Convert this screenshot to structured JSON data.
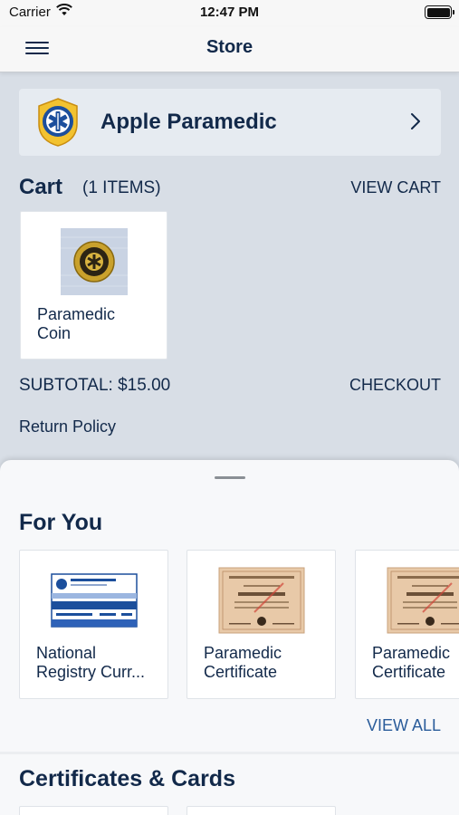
{
  "status_bar": {
    "carrier": "Carrier",
    "time": "12:47 PM"
  },
  "nav": {
    "title": "Store",
    "menu_icon": "hamburger-menu-icon"
  },
  "store": {
    "name": "Apple Paramedic",
    "chevron_icon": "chevron-right-icon",
    "logo_icon": "ems-star-of-life-logo"
  },
  "cart": {
    "title": "Cart",
    "count_label": "(1 ITEMS)",
    "view_cart_label": "VIEW CART",
    "items": [
      {
        "name_line1": "Paramedic",
        "name_line2": "Coin"
      }
    ],
    "subtotal_label": "SUBTOTAL: $15.00",
    "checkout_label": "CHECKOUT",
    "return_policy_label": "Return Policy"
  },
  "for_you": {
    "title": "For You",
    "view_all_label": "VIEW ALL",
    "products": [
      {
        "name_line1": "National",
        "name_line2": "Registry Curr..."
      },
      {
        "name_line1": "Paramedic",
        "name_line2": "Certificate"
      },
      {
        "name_line1": "Paramedic",
        "name_line2": "Certificate"
      }
    ]
  },
  "certificates": {
    "title": "Certificates & Cards"
  },
  "colors": {
    "primary_text": "#12294a",
    "link": "#2a5c9a",
    "background": "#d8dee6",
    "card": "#ffffff"
  }
}
